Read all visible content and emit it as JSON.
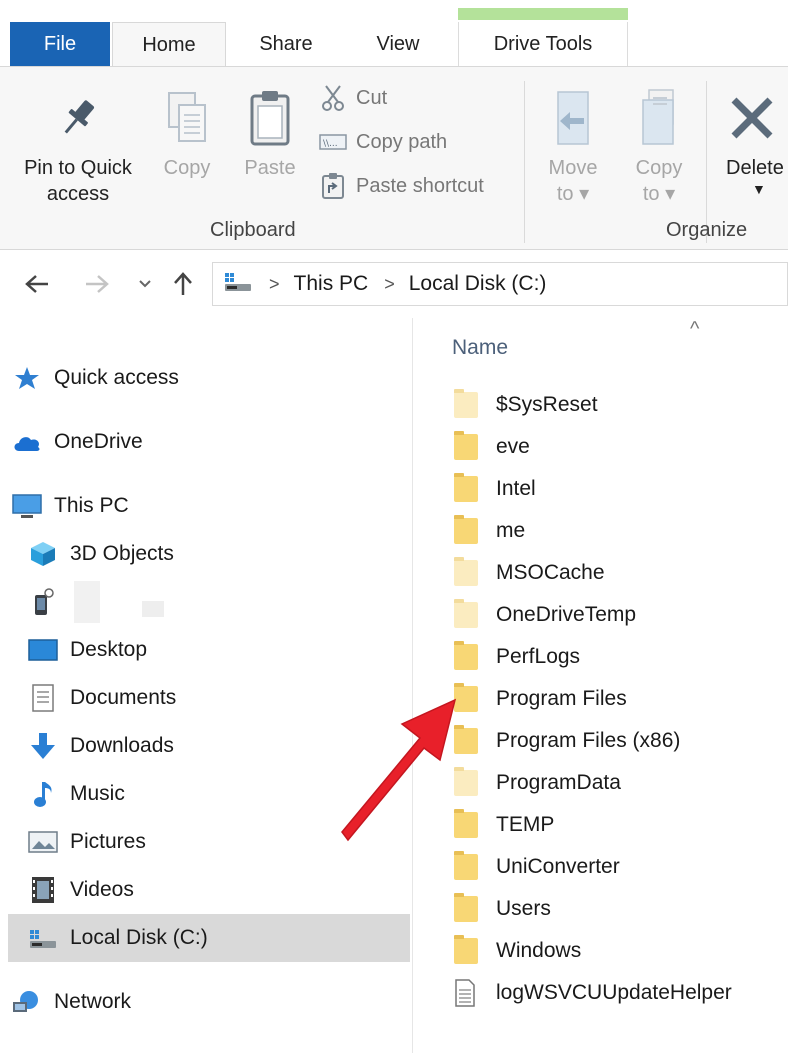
{
  "tabs": {
    "file": "File",
    "home": "Home",
    "share": "Share",
    "view": "View",
    "drive_tools": "Drive Tools"
  },
  "ribbon": {
    "pin_line1": "Pin to Quick",
    "pin_line2": "access",
    "copy": "Copy",
    "paste": "Paste",
    "cut": "Cut",
    "copy_path": "Copy path",
    "paste_shortcut": "Paste shortcut",
    "clipboard_group": "Clipboard",
    "move_to_line1": "Move",
    "move_to_line2": "to",
    "copy_to_line1": "Copy",
    "copy_to_line2": "to",
    "delete": "Delete",
    "organize_group": "Organize"
  },
  "address": {
    "this_pc": "This PC",
    "local_disk": "Local Disk (C:)"
  },
  "nav_pane": {
    "quick_access": "Quick access",
    "onedrive": "OneDrive",
    "this_pc": "This PC",
    "objects_3d": "3D Objects",
    "desktop": "Desktop",
    "documents": "Documents",
    "downloads": "Downloads",
    "music": "Music",
    "pictures": "Pictures",
    "videos": "Videos",
    "local_disk": "Local Disk (C:)",
    "network": "Network"
  },
  "file_list": {
    "column_name": "Name",
    "items": [
      {
        "name": "$SysReset"
      },
      {
        "name": "eve"
      },
      {
        "name": "Intel"
      },
      {
        "name": "me"
      },
      {
        "name": "MSOCache"
      },
      {
        "name": "OneDriveTemp"
      },
      {
        "name": "PerfLogs"
      },
      {
        "name": "Program Files"
      },
      {
        "name": "Program Files (x86)"
      },
      {
        "name": "ProgramData"
      },
      {
        "name": "TEMP"
      },
      {
        "name": "UniConverter"
      },
      {
        "name": "Users"
      },
      {
        "name": "Windows"
      },
      {
        "name": "logWSVCUUpdateHelper"
      }
    ]
  },
  "colors": {
    "file_tab": "#1a64b4",
    "context_band": "#b4e29a",
    "folder": "#f8d775",
    "arrow": "#e8202a",
    "selection": "#d9d9d9"
  }
}
